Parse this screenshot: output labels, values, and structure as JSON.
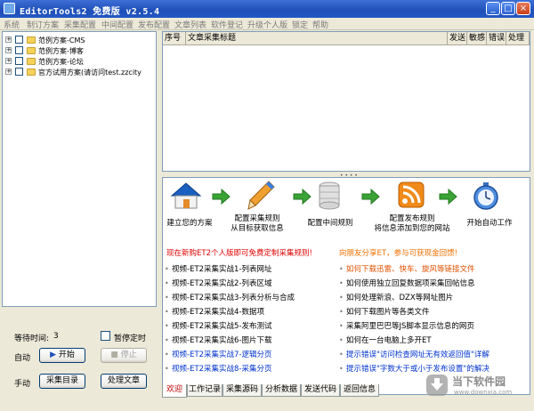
{
  "window": {
    "title": "EditorTools2 免费版 v2.5.4",
    "min_glyph": "_",
    "max_glyph": "□",
    "close_glyph": "×"
  },
  "menu": [
    "系统",
    "制订方案",
    "采集配置",
    "中间配置",
    "发布配置",
    "文章列表",
    "软件登记",
    "升级个人版",
    "锁定",
    "帮助"
  ],
  "tree": [
    {
      "label": "范例方案-CMS"
    },
    {
      "label": "范例方案-博客"
    },
    {
      "label": "范例方案-论坛"
    },
    {
      "label": "官方试用方案(请访问test.zzcity"
    }
  ],
  "controls": {
    "wait_label": "等待时间:",
    "wait_value": "3",
    "pause_label": "暂停定时",
    "auto_label": "自动",
    "start_label": "开始",
    "stop_label": "停止",
    "manual_label": "手动",
    "collect_label": "采集目录",
    "process_label": "处理文章"
  },
  "grid": {
    "columns": [
      "序号",
      "文章采集标题",
      "发送",
      "敏感",
      "错误",
      "处理"
    ]
  },
  "workflow": [
    {
      "icon": "home-icon",
      "line1": "建立您的方案",
      "line2": ""
    },
    {
      "icon": "pencil-icon",
      "line1": "配置采集规则",
      "line2": "从目标获取信息"
    },
    {
      "icon": "database-icon",
      "line1": "配置中间规则",
      "line2": ""
    },
    {
      "icon": "rss-icon",
      "line1": "配置发布规则",
      "line2": "将信息添加到您的网站"
    },
    {
      "icon": "clock-icon",
      "line1": "开始自动工作",
      "line2": ""
    }
  ],
  "promo": {
    "left": "现在新购ET2个人版即可免费定制采集规则!",
    "right": "向朋友分享ET，参与可获现金回馈!"
  },
  "links_left": [
    "视频-ET2采集实战1-列表网址",
    "视频-ET2采集实战2-列表区域",
    "视频-ET2采集实战3-列表分析与合成",
    "视频-ET2采集实战4-数据项",
    "视频-ET2采集实战5-发布测试",
    "视频-ET2采集实战6-图片下载",
    "视频-ET2采集实战7-逻辑分页",
    "视频-ET2采集实战8-采集分页"
  ],
  "links_right": [
    "如何下载迅雷、快车、旋风等链接文件",
    "如何使用独立回复数据项采集回帖信息",
    "如何处理新浪、DZX等网址图片",
    "如何下载图片等各类文件",
    "采集阿里巴巴等JS脚本显示信息的网页",
    "如何在一台电脑上多开ET",
    "提示错误\"访问检查网址无有效返回值\"详解",
    "提示错误\"字数大于或小于发布设置\"的解决"
  ],
  "tabs": [
    "欢迎",
    "工作记录",
    "采集源码",
    "分析数据",
    "发送代码",
    "返回信息"
  ],
  "watermark": {
    "brand": "当下软件园",
    "url": "www.downxia.com"
  },
  "colors": {
    "title_bar": "#2457c4",
    "promo_red": "#e00000",
    "promo_orange": "#f07000",
    "link_dark": "#000000",
    "link_blue": "#0033cc",
    "link_orange_red": "#e05000",
    "arrow_green": "#3aa335"
  }
}
